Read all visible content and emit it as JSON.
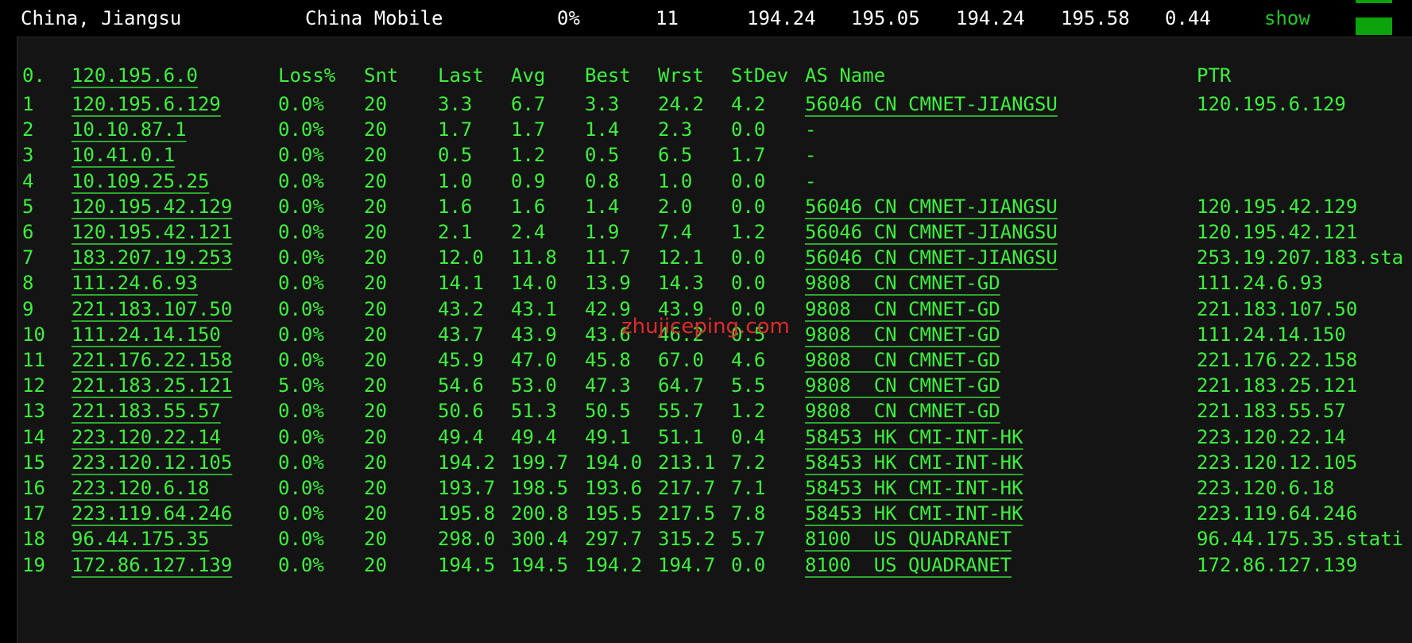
{
  "summary": {
    "location": "China, Jiangsu",
    "isp": "China Mobile",
    "loss": "0%",
    "hops": "11",
    "v1": "194.24",
    "v2": "195.05",
    "v3": "194.24",
    "v4": "195.58",
    "v5": "0.44",
    "show_label": "show"
  },
  "colors": {
    "terminal_green": "#3cf03c",
    "watermark_red": "#e02a2a",
    "bar_green": "#0ca30c"
  },
  "header": {
    "hop": "0.",
    "host": "120.195.6.0",
    "loss": "Loss%",
    "snt": "Snt",
    "last": "Last",
    "avg": "Avg",
    "best": "Best",
    "wrst": "Wrst",
    "stdev": "StDev",
    "as": "AS Name",
    "ptr": "PTR"
  },
  "hops": [
    {
      "hop": "1",
      "host": "120.195.6.129",
      "loss": "0.0%",
      "snt": "20",
      "last": "3.3",
      "avg": "6.7",
      "best": "3.3",
      "wrst": "24.2",
      "stdev": "4.2",
      "as": "56046 CN CMNET-JIANGSU",
      "ptr": "120.195.6.129"
    },
    {
      "hop": "2",
      "host": "10.10.87.1",
      "loss": "0.0%",
      "snt": "20",
      "last": "1.7",
      "avg": "1.7",
      "best": "1.4",
      "wrst": "2.3",
      "stdev": "0.0",
      "as": "-",
      "ptr": ""
    },
    {
      "hop": "3",
      "host": "10.41.0.1",
      "loss": "0.0%",
      "snt": "20",
      "last": "0.5",
      "avg": "1.2",
      "best": "0.5",
      "wrst": "6.5",
      "stdev": "1.7",
      "as": "-",
      "ptr": ""
    },
    {
      "hop": "4",
      "host": "10.109.25.25",
      "loss": "0.0%",
      "snt": "20",
      "last": "1.0",
      "avg": "0.9",
      "best": "0.8",
      "wrst": "1.0",
      "stdev": "0.0",
      "as": "-",
      "ptr": ""
    },
    {
      "hop": "5",
      "host": "120.195.42.129",
      "loss": "0.0%",
      "snt": "20",
      "last": "1.6",
      "avg": "1.6",
      "best": "1.4",
      "wrst": "2.0",
      "stdev": "0.0",
      "as": "56046 CN CMNET-JIANGSU",
      "ptr": "120.195.42.129"
    },
    {
      "hop": "6",
      "host": "120.195.42.121",
      "loss": "0.0%",
      "snt": "20",
      "last": "2.1",
      "avg": "2.4",
      "best": "1.9",
      "wrst": "7.4",
      "stdev": "1.2",
      "as": "56046 CN CMNET-JIANGSU",
      "ptr": "120.195.42.121"
    },
    {
      "hop": "7",
      "host": "183.207.19.253",
      "loss": "0.0%",
      "snt": "20",
      "last": "12.0",
      "avg": "11.8",
      "best": "11.7",
      "wrst": "12.1",
      "stdev": "0.0",
      "as": "56046 CN CMNET-JIANGSU",
      "ptr": "253.19.207.183.sta"
    },
    {
      "hop": "8",
      "host": "111.24.6.93",
      "loss": "0.0%",
      "snt": "20",
      "last": "14.1",
      "avg": "14.0",
      "best": "13.9",
      "wrst": "14.3",
      "stdev": "0.0",
      "as": "9808  CN CMNET-GD",
      "ptr": "111.24.6.93"
    },
    {
      "hop": "9",
      "host": "221.183.107.50",
      "loss": "0.0%",
      "snt": "20",
      "last": "43.2",
      "avg": "43.1",
      "best": "42.9",
      "wrst": "43.9",
      "stdev": "0.0",
      "as": "9808  CN CMNET-GD",
      "ptr": "221.183.107.50"
    },
    {
      "hop": "10",
      "host": "111.24.14.150",
      "loss": "0.0%",
      "snt": "20",
      "last": "43.7",
      "avg": "43.9",
      "best": "43.6",
      "wrst": "46.2",
      "stdev": "0.5",
      "as": "9808  CN CMNET-GD",
      "ptr": "111.24.14.150"
    },
    {
      "hop": "11",
      "host": "221.176.22.158",
      "loss": "0.0%",
      "snt": "20",
      "last": "45.9",
      "avg": "47.0",
      "best": "45.8",
      "wrst": "67.0",
      "stdev": "4.6",
      "as": "9808  CN CMNET-GD",
      "ptr": "221.176.22.158"
    },
    {
      "hop": "12",
      "host": "221.183.25.121",
      "loss": "5.0%",
      "snt": "20",
      "last": "54.6",
      "avg": "53.0",
      "best": "47.3",
      "wrst": "64.7",
      "stdev": "5.5",
      "as": "9808  CN CMNET-GD",
      "ptr": "221.183.25.121"
    },
    {
      "hop": "13",
      "host": "221.183.55.57",
      "loss": "0.0%",
      "snt": "20",
      "last": "50.6",
      "avg": "51.3",
      "best": "50.5",
      "wrst": "55.7",
      "stdev": "1.2",
      "as": "9808  CN CMNET-GD",
      "ptr": "221.183.55.57"
    },
    {
      "hop": "14",
      "host": "223.120.22.14",
      "loss": "0.0%",
      "snt": "20",
      "last": "49.4",
      "avg": "49.4",
      "best": "49.1",
      "wrst": "51.1",
      "stdev": "0.4",
      "as": "58453 HK CMI-INT-HK",
      "ptr": "223.120.22.14"
    },
    {
      "hop": "15",
      "host": "223.120.12.105",
      "loss": "0.0%",
      "snt": "20",
      "last": "194.2",
      "avg": "199.7",
      "best": "194.0",
      "wrst": "213.1",
      "stdev": "7.2",
      "as": "58453 HK CMI-INT-HK",
      "ptr": "223.120.12.105"
    },
    {
      "hop": "16",
      "host": "223.120.6.18",
      "loss": "0.0%",
      "snt": "20",
      "last": "193.7",
      "avg": "198.5",
      "best": "193.6",
      "wrst": "217.7",
      "stdev": "7.1",
      "as": "58453 HK CMI-INT-HK",
      "ptr": "223.120.6.18"
    },
    {
      "hop": "17",
      "host": "223.119.64.246",
      "loss": "0.0%",
      "snt": "20",
      "last": "195.8",
      "avg": "200.8",
      "best": "195.5",
      "wrst": "217.5",
      "stdev": "7.8",
      "as": "58453 HK CMI-INT-HK",
      "ptr": "223.119.64.246"
    },
    {
      "hop": "18",
      "host": "96.44.175.35",
      "loss": "0.0%",
      "snt": "20",
      "last": "298.0",
      "avg": "300.4",
      "best": "297.7",
      "wrst": "315.2",
      "stdev": "5.7",
      "as": "8100  US QUADRANET",
      "ptr": "96.44.175.35.stati"
    },
    {
      "hop": "19",
      "host": "172.86.127.139",
      "loss": "0.0%",
      "snt": "20",
      "last": "194.5",
      "avg": "194.5",
      "best": "194.2",
      "wrst": "194.7",
      "stdev": "0.0",
      "as": "8100  US QUADRANET",
      "ptr": "172.86.127.139"
    }
  ],
  "watermark": "zhujiceping.com"
}
